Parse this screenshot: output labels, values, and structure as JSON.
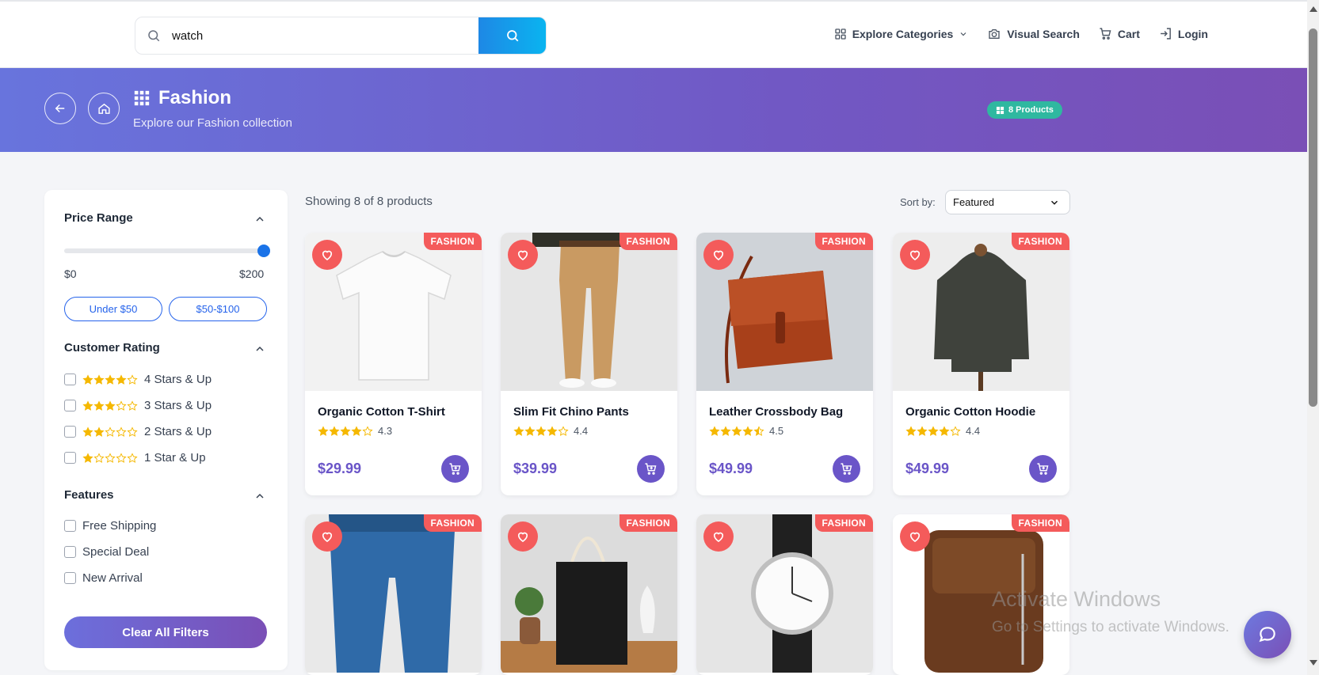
{
  "header": {
    "search": {
      "value": "watch",
      "placeholder": ""
    },
    "nav": [
      {
        "label": "Explore Categories",
        "icon": "grid-icon"
      },
      {
        "label": "Visual Search",
        "icon": "camera-icon"
      },
      {
        "label": "Cart",
        "icon": "cart-icon"
      },
      {
        "label": "Login",
        "icon": "login-icon"
      }
    ]
  },
  "banner": {
    "title": "Fashion",
    "subtitle": "Explore our Fashion collection",
    "badge": "8 Products"
  },
  "filters": {
    "price": {
      "title": "Price Range",
      "min_label": "$0",
      "max_label": "$200",
      "slider_value_fraction": 1.0,
      "chips": [
        "Under $50",
        "$50-$100"
      ]
    },
    "rating": {
      "title": "Customer Rating",
      "options": [
        {
          "label": "4 Stars & Up",
          "stars": 4
        },
        {
          "label": "3 Stars & Up",
          "stars": 3
        },
        {
          "label": "2 Stars & Up",
          "stars": 2
        },
        {
          "label": "1 Star & Up",
          "stars": 1
        }
      ]
    },
    "features": {
      "title": "Features",
      "options": [
        "Free Shipping",
        "Special Deal",
        "New Arrival"
      ]
    },
    "clear_label": "Clear All Filters"
  },
  "results": {
    "showing": "Showing 8 of 8 products",
    "sort_label": "Sort by:",
    "sort_value": "Featured"
  },
  "products": [
    {
      "name": "Organic Cotton T-Shirt",
      "rating": "4.3",
      "price": "$29.99",
      "tag": "FASHION"
    },
    {
      "name": "Slim Fit Chino Pants",
      "rating": "4.4",
      "price": "$39.99",
      "tag": "FASHION"
    },
    {
      "name": "Leather Crossbody Bag",
      "rating": "4.5",
      "price": "$49.99",
      "tag": "FASHION"
    },
    {
      "name": "Organic Cotton Hoodie",
      "rating": "4.4",
      "price": "$49.99",
      "tag": "FASHION"
    },
    {
      "name": "",
      "rating": "",
      "price": "",
      "tag": "FASHION"
    },
    {
      "name": "",
      "rating": "",
      "price": "",
      "tag": "FASHION"
    },
    {
      "name": "",
      "rating": "",
      "price": "",
      "tag": "FASHION"
    },
    {
      "name": "",
      "rating": "",
      "price": "",
      "tag": "FASHION"
    }
  ],
  "watermark": {
    "line1": "Activate Windows",
    "line2": "Go to Settings to activate Windows."
  },
  "colors": {
    "accent": "#6a55c8",
    "banner_start": "#6874dd",
    "banner_end": "#7a4fb6",
    "tag": "#f45b5b",
    "badge": "#2fb8a0",
    "search_button": "#1e88e5",
    "star": "#f5b800"
  }
}
